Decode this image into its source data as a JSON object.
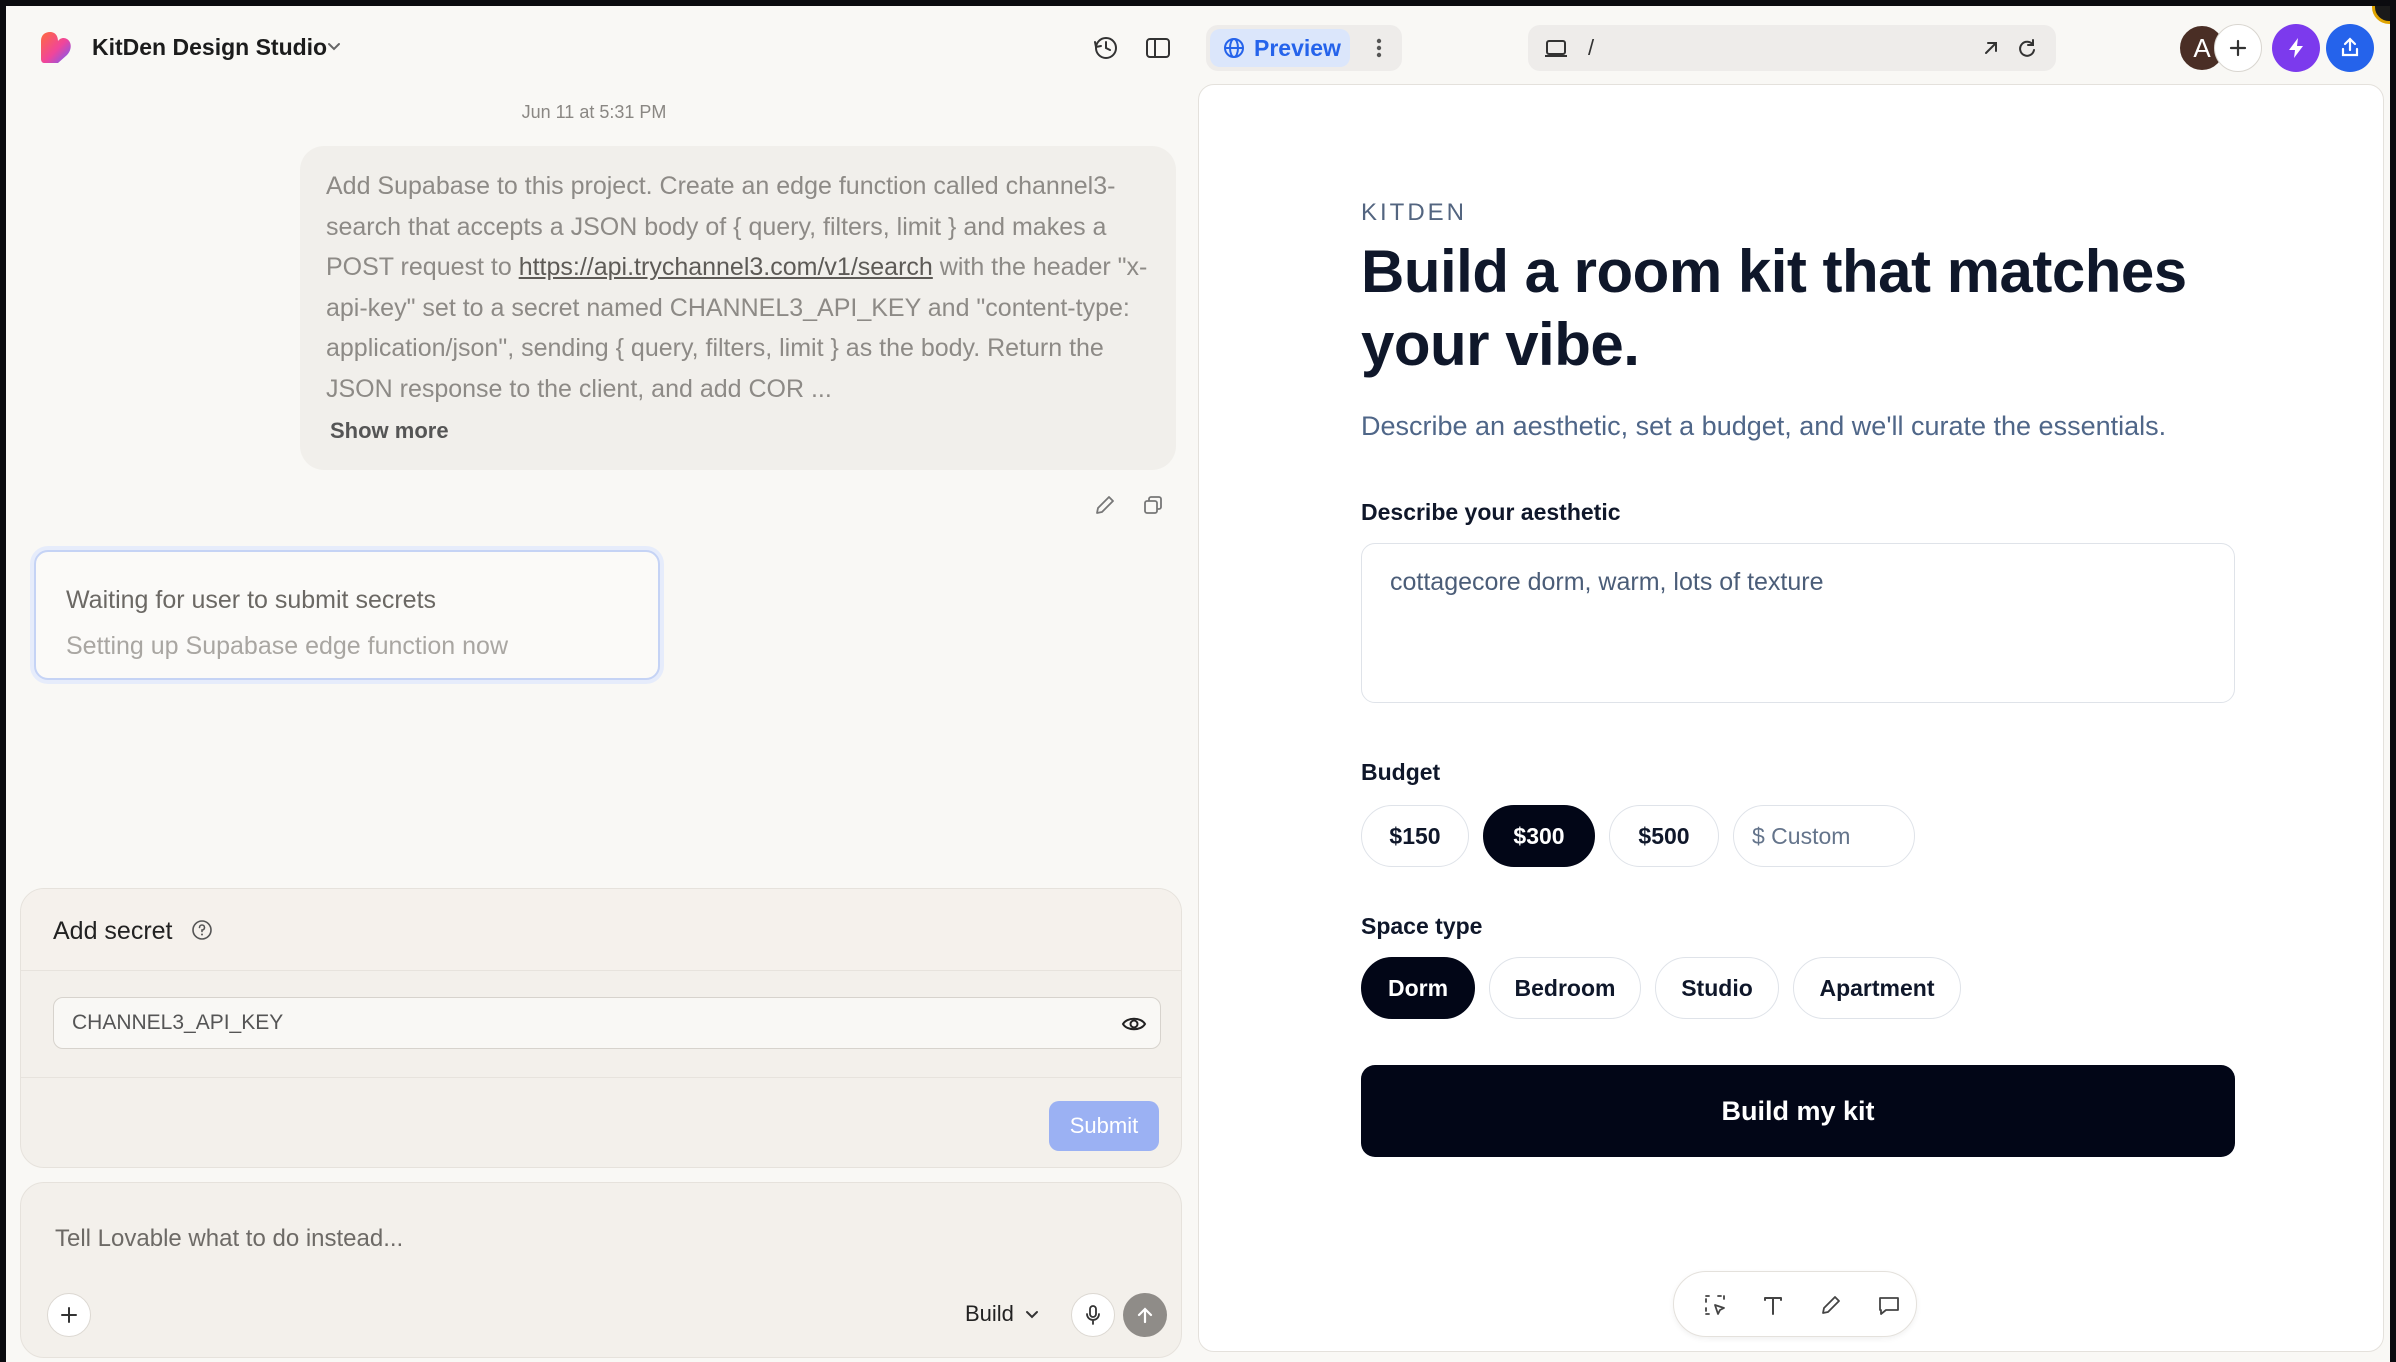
{
  "header": {
    "project_name": "KitDen Design Studio",
    "preview_label": "Preview",
    "url_path": "/",
    "avatar_initial": "A",
    "colors": {
      "accent": "#2563eb",
      "bolt": "#7c3aed"
    }
  },
  "chat": {
    "timestamp": "Jun 11 at 5:31 PM",
    "message": {
      "before_link": "Add Supabase to this project. Create an edge function called channel3-search that accepts a JSON body of { query, filters, limit } and makes a POST request to ",
      "link": "https://api.trychannel3.com/v1/search",
      "after_link": " with the header \"x-api-key\" set to a secret named CHANNEL3_API_KEY and \"content-type: application/json\", sending { query, filters, limit } as the body. Return the JSON response to the client, and add COR ..."
    },
    "show_more": "Show more",
    "status": {
      "title": "Waiting for user to submit secrets",
      "subtitle": "Setting up Supabase edge function now"
    },
    "secret": {
      "title": "Add secret",
      "key_value": "CHANNEL3_API_KEY",
      "submit_label": "Submit"
    },
    "composer": {
      "placeholder": "Tell Lovable what to do instead...",
      "mode": "Build"
    }
  },
  "preview": {
    "brand": "KITDEN",
    "headline_line1": "Build a room kit that matches",
    "headline_line2": "your vibe.",
    "subheadline": "Describe an aesthetic, set a budget, and we'll curate the essentials.",
    "aesthetic_label": "Describe your aesthetic",
    "aesthetic_value": "cottagecore dorm, warm, lots of texture",
    "budget_label": "Budget",
    "budget_options": [
      "$150",
      "$300",
      "$500"
    ],
    "budget_selected": "$300",
    "budget_custom_placeholder": "$ Custom",
    "space_label": "Space type",
    "space_options": [
      "Dorm",
      "Bedroom",
      "Studio",
      "Apartment"
    ],
    "space_selected": "Dorm",
    "cta": "Build my kit"
  },
  "icons": {
    "header": [
      "lovable-logo-icon",
      "chevron-down-icon",
      "history-icon",
      "sidebar-toggle-icon",
      "globe-icon",
      "more-vertical-icon",
      "device-icon",
      "open-external-icon",
      "refresh-icon",
      "plus-icon",
      "bolt-icon",
      "share-icon"
    ],
    "chat": [
      "edit-icon",
      "copy-icon",
      "help-icon",
      "eye-icon",
      "plus-icon",
      "mic-icon",
      "send-icon"
    ],
    "edit_toolbar": [
      "select-element-icon",
      "text-icon",
      "pencil-icon",
      "comment-icon"
    ]
  }
}
